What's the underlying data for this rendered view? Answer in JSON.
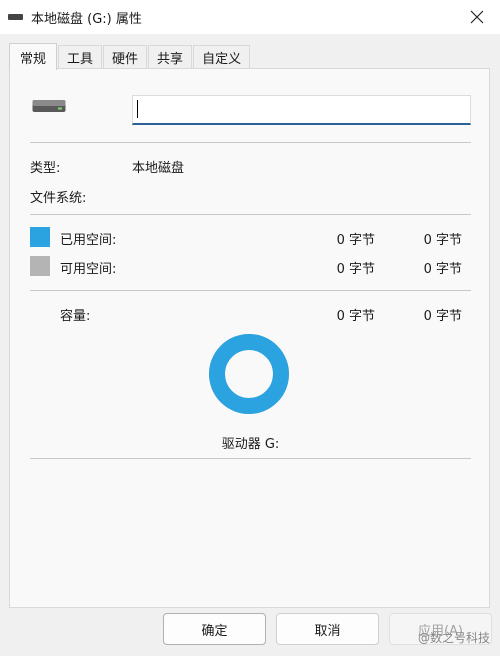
{
  "window": {
    "title": "本地磁盘 (G:) 属性",
    "icon": "drive-icon",
    "close_icon": "close-icon"
  },
  "tabs": [
    {
      "label": "常规",
      "active": true
    },
    {
      "label": "工具",
      "active": false
    },
    {
      "label": "硬件",
      "active": false
    },
    {
      "label": "共享",
      "active": false
    },
    {
      "label": "自定义",
      "active": false
    }
  ],
  "general": {
    "name_value": "",
    "type_label": "类型:",
    "type_value": "本地磁盘",
    "fs_label": "文件系统:",
    "fs_value": "",
    "used": {
      "label": "已用空间:",
      "bytes": "0 字节",
      "size": "0 字节",
      "color": "#2ba3e0"
    },
    "free": {
      "label": "可用空间:",
      "bytes": "0 字节",
      "size": "0 字节",
      "color": "#b4b4b4"
    },
    "capacity": {
      "label": "容量:",
      "bytes": "0 字节",
      "size": "0 字节"
    },
    "drive_label": "驱动器 G:",
    "used_fraction": 1
  },
  "buttons": {
    "ok": "确定",
    "cancel": "取消",
    "apply": "应用(A)"
  },
  "watermark": "@数之号科技"
}
